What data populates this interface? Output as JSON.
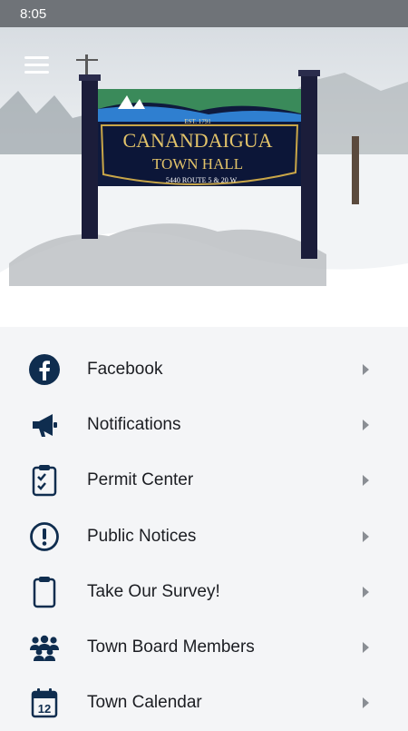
{
  "status_bar": {
    "time": "8:05"
  },
  "hero": {
    "sign_est": "EST. 1791",
    "sign_line1": "CANANDAIGUA",
    "sign_line2": "TOWN HALL",
    "sign_address": "5440 ROUTE 5 & 20 W"
  },
  "menu": {
    "items": [
      {
        "label": "Facebook",
        "icon": "facebook-icon"
      },
      {
        "label": "Notifications",
        "icon": "megaphone-icon"
      },
      {
        "label": "Permit Center",
        "icon": "clipboard-check-icon"
      },
      {
        "label": "Public Notices",
        "icon": "exclamation-circle-icon"
      },
      {
        "label": "Take Our Survey!",
        "icon": "clipboard-icon"
      },
      {
        "label": "Town Board Members",
        "icon": "users-group-icon"
      },
      {
        "label": "Town Calendar",
        "icon": "calendar-icon"
      }
    ]
  },
  "colors": {
    "icon": "#0f2d4f",
    "status_bar": "#6f7378",
    "background": "#f4f5f7"
  }
}
